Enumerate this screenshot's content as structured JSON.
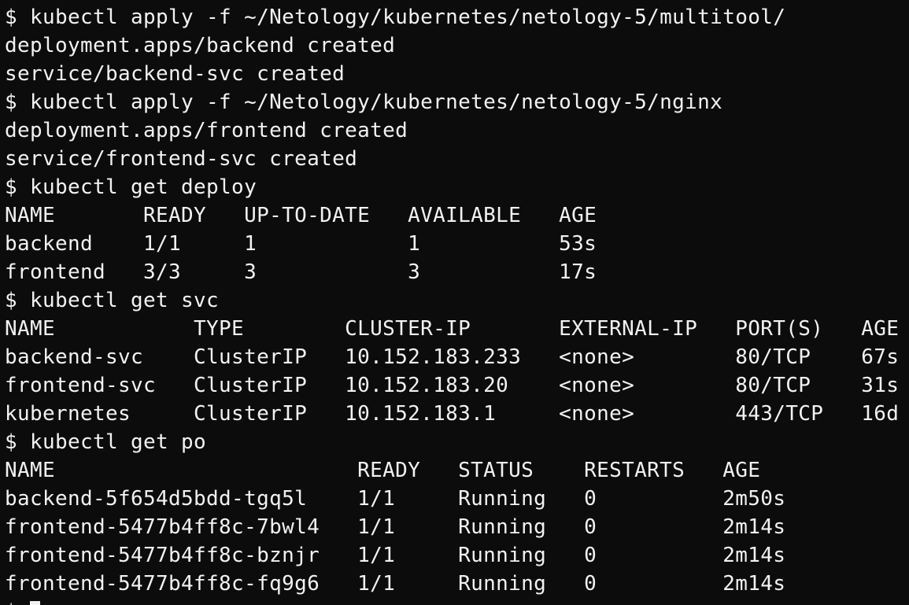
{
  "terminal": {
    "lines": [
      "$ kubectl apply -f ~/Netology/kubernetes/netology-5/multitool/",
      "deployment.apps/backend created",
      "service/backend-svc created",
      "$ kubectl apply -f ~/Netology/kubernetes/netology-5/nginx",
      "deployment.apps/frontend created",
      "service/frontend-svc created",
      "$ kubectl get deploy",
      "NAME       READY   UP-TO-DATE   AVAILABLE   AGE",
      "backend    1/1     1            1           53s",
      "frontend   3/3     3            3           17s",
      "$ kubectl get svc",
      "NAME           TYPE        CLUSTER-IP       EXTERNAL-IP   PORT(S)   AGE",
      "backend-svc    ClusterIP   10.152.183.233   <none>        80/TCP    67s",
      "frontend-svc   ClusterIP   10.152.183.20    <none>        80/TCP    31s",
      "kubernetes     ClusterIP   10.152.183.1     <none>        443/TCP   16d",
      "$ kubectl get po",
      "NAME                        READY   STATUS    RESTARTS   AGE",
      "backend-5f654d5bdd-tgq5l    1/1     Running   0          2m50s",
      "frontend-5477b4ff8c-7bwl4   1/1     Running   0          2m14s",
      "frontend-5477b4ff8c-bznjr   1/1     Running   0          2m14s",
      "frontend-5477b4ff8c-fq9g6   1/1     Running   0          2m14s"
    ],
    "prompt": "$ "
  }
}
